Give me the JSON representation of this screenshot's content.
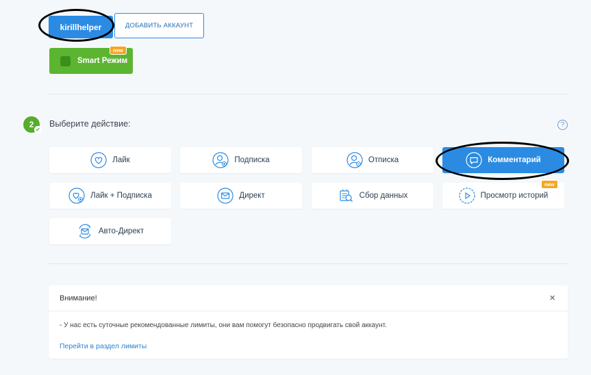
{
  "accounts": {
    "current": "kirillhelper",
    "add_label": "ДОБАВИТЬ АККАУНТ"
  },
  "smart_mode": {
    "label": "Smart Режим",
    "badge": "new"
  },
  "step": {
    "number": "2",
    "title": "Выберите действие:",
    "help": "?"
  },
  "actions": [
    {
      "label": "Лайк",
      "icon": "heart-icon"
    },
    {
      "label": "Подписка",
      "icon": "user-plus-icon"
    },
    {
      "label": "Отписка",
      "icon": "user-minus-icon"
    },
    {
      "label": "Комментарий",
      "icon": "comment-icon",
      "active": true
    },
    {
      "label": "Лайк + Подписка",
      "icon": "heart-user-icon"
    },
    {
      "label": "Директ",
      "icon": "mail-icon"
    },
    {
      "label": "Сбор данных",
      "icon": "data-collect-icon"
    },
    {
      "label": "Просмотр историй",
      "icon": "play-icon",
      "badge": "new"
    },
    {
      "label": "Авто-Директ",
      "icon": "auto-mail-icon"
    }
  ],
  "notice": {
    "title": "Внимание!",
    "close": "×",
    "text": "- У нас есть суточные рекомендованные лимиты, они вам помогут безопасно продвигать свой аккаунт.",
    "link": "Перейти в раздел лимиты"
  },
  "colors": {
    "primary": "#2b8be3",
    "green": "#5cb531",
    "badge": "#f5a623",
    "background": "#f5f8fb"
  }
}
